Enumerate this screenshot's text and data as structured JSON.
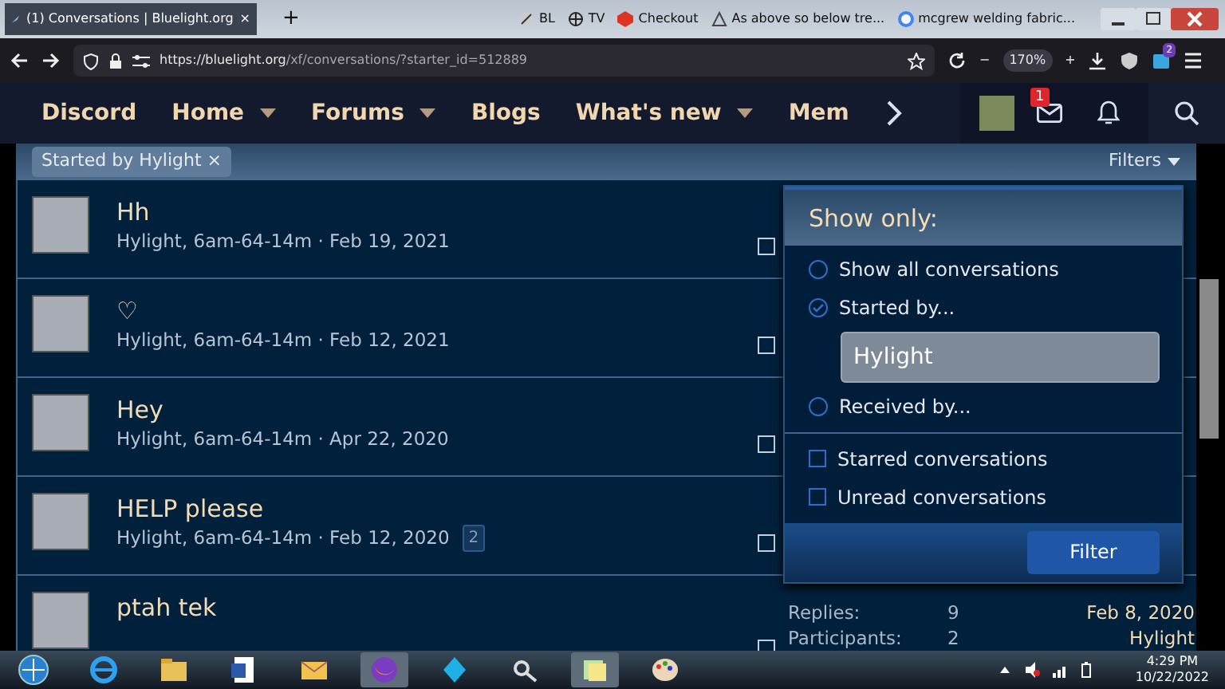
{
  "browser": {
    "tab_title": "(1) Conversations | Bluelight.org",
    "tab_close": "×",
    "new_tab": "+",
    "bookmarks": [
      "BL",
      "TV",
      "Checkout",
      "As above so below tre...",
      "mcgrew welding fabric..."
    ],
    "url_host": "https://bluelight.org",
    "url_path": "/xf/conversations/?starter_id=512889",
    "zoom_minus": "−",
    "zoom": "170%",
    "zoom_plus": "+",
    "extension_badge": "2"
  },
  "nav": {
    "items": [
      {
        "label": "Discord",
        "dropdown": false
      },
      {
        "label": "Home",
        "dropdown": true
      },
      {
        "label": "Forums",
        "dropdown": true
      },
      {
        "label": "Blogs",
        "dropdown": false
      },
      {
        "label": "What's new",
        "dropdown": true
      },
      {
        "label": "Mem",
        "dropdown": false
      }
    ],
    "mail_badge": "1"
  },
  "filter_bar": {
    "chip": "Started by Hylight",
    "chip_close": "×",
    "filters": "Filters"
  },
  "conversations": [
    {
      "title": "Hh",
      "meta": "Hylight, 6am-64-14m · Feb 19, 2021",
      "checked": false
    },
    {
      "title": "♡",
      "meta": "Hylight, 6am-64-14m · Feb 12, 2021",
      "checked": false
    },
    {
      "title": "Hey",
      "meta": "Hylight, 6am-64-14m · Apr 22, 2020",
      "checked": false
    },
    {
      "title": "HELP please",
      "meta": "Hylight, 6am-64-14m · Feb 12, 2020",
      "pages": "2",
      "checked": false
    },
    {
      "title": "ptah tek",
      "checked": false,
      "stats": [
        {
          "label": "Replies:",
          "value": "9",
          "extra": "Feb 8, 2020"
        },
        {
          "label": "Participants:",
          "value": "2",
          "extra": "Hylight"
        }
      ]
    }
  ],
  "popup": {
    "heading": "Show only:",
    "options": [
      {
        "kind": "radio",
        "label": "Show all conversations",
        "selected": false
      },
      {
        "kind": "radio",
        "label": "Started by...",
        "selected": true
      },
      {
        "kind": "field",
        "value": "Hylight"
      },
      {
        "kind": "radio",
        "label": "Received by...",
        "selected": false
      },
      {
        "kind": "divider"
      },
      {
        "kind": "checkbox",
        "label": "Starred conversations",
        "checked": false
      },
      {
        "kind": "checkbox",
        "label": "Unread conversations",
        "checked": false
      }
    ],
    "button": "Filter"
  },
  "taskbar": {
    "time": "4:29 PM",
    "date": "10/22/2022"
  }
}
